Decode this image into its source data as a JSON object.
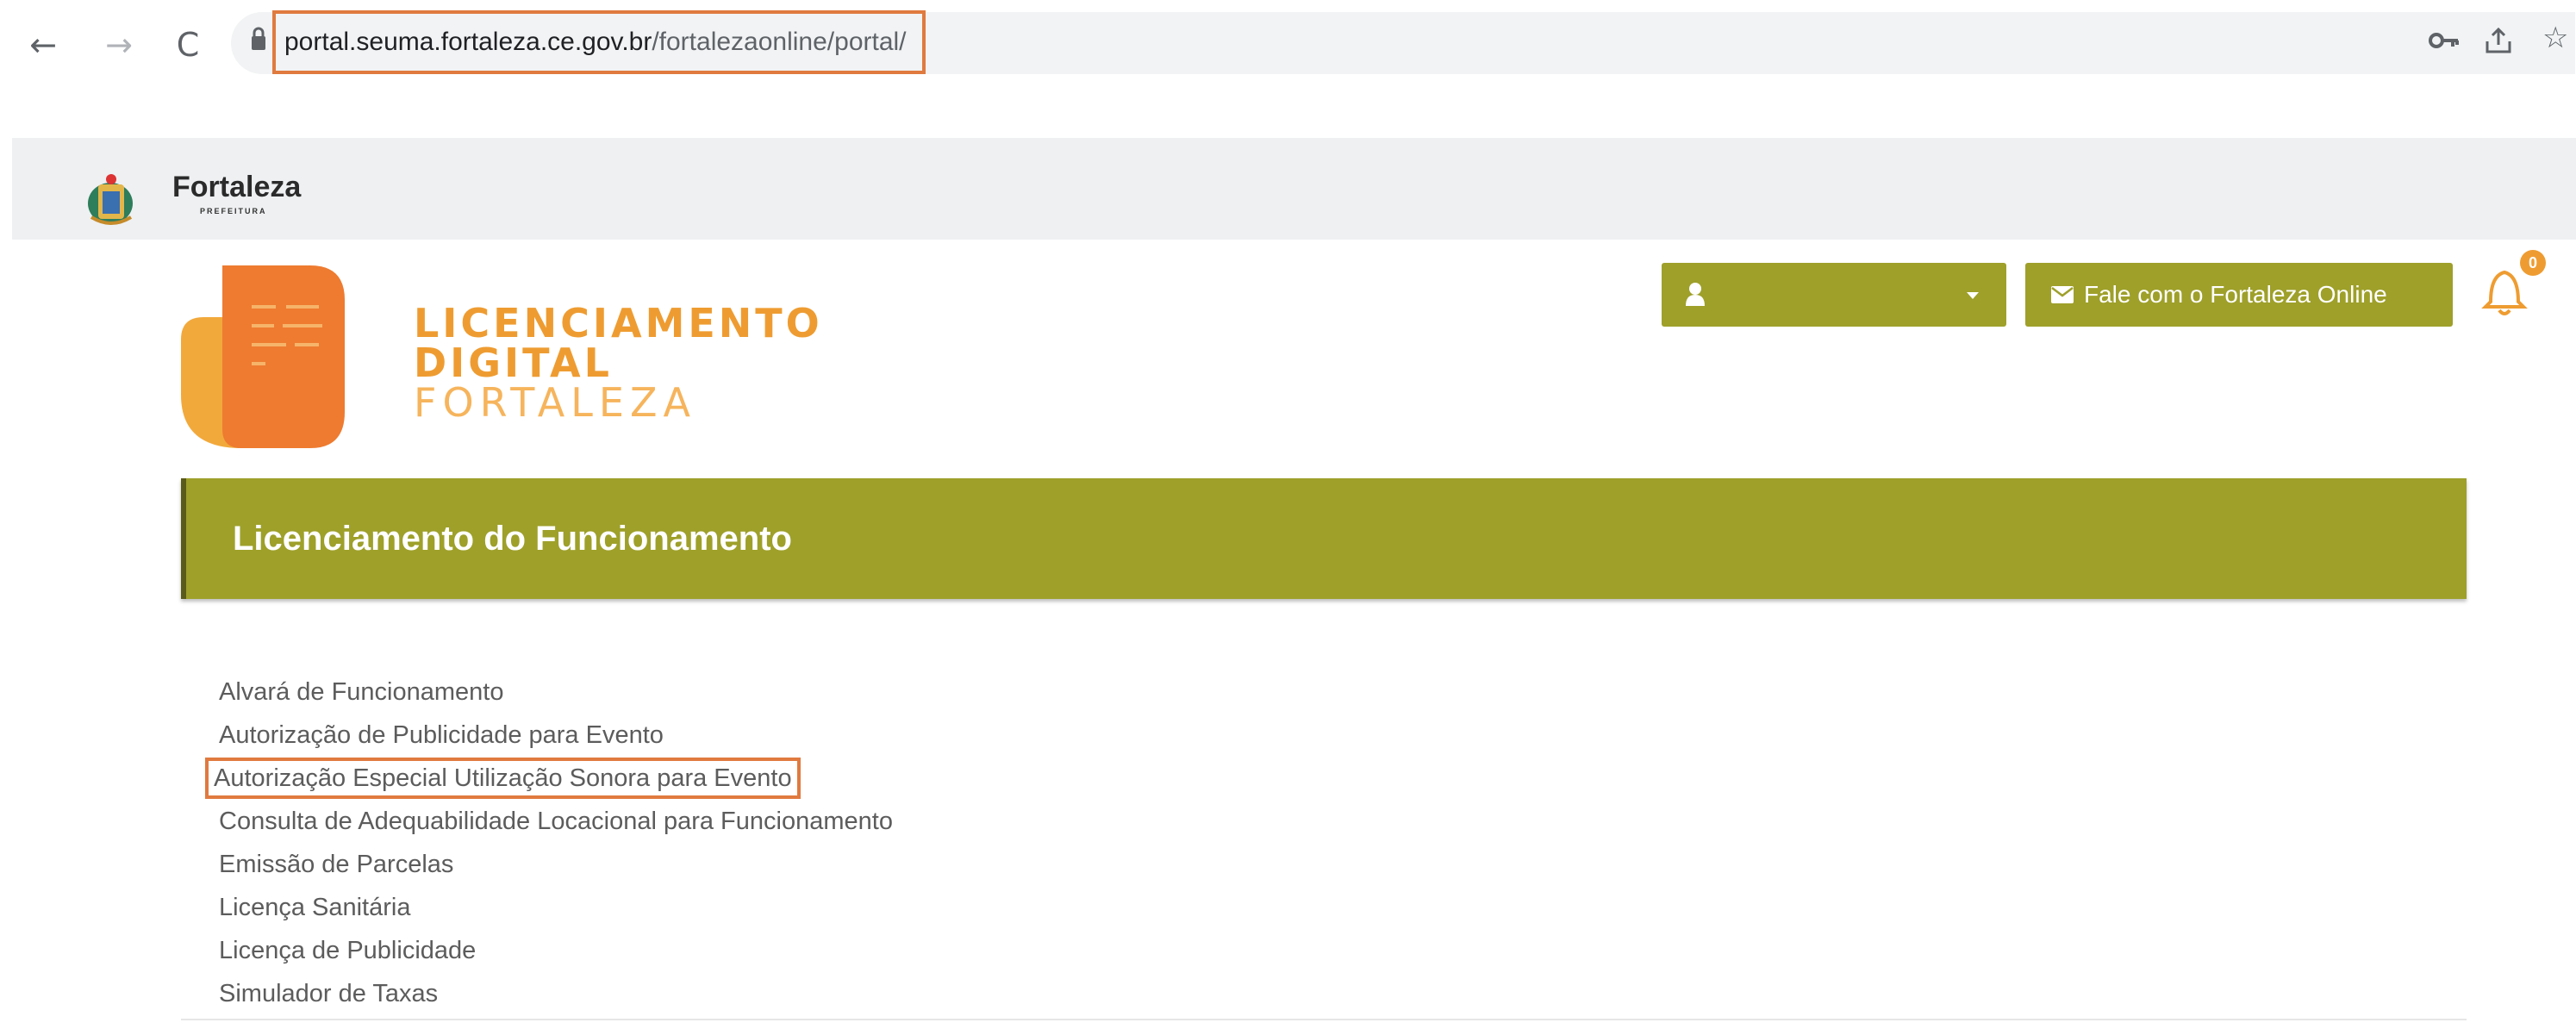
{
  "browser": {
    "url_host": "portal.seuma.fortaleza.ce.gov.br",
    "url_path": "/fortalezaonline/portal/"
  },
  "header": {
    "gov_title": "Fortaleza",
    "gov_subtitle": "PREFEITURA"
  },
  "brand": {
    "line1": "LICENCIAMENTO",
    "line2": "DIGITAL",
    "line3": "FORTALEZA",
    "color_primary": "#ee9c31"
  },
  "topbar": {
    "user_label": "",
    "contact_label": "Fale com o Fortaleza Online",
    "notification_count": "0",
    "accent_color": "#9ea02a"
  },
  "section": {
    "title": "Licenciamento do Funcionamento"
  },
  "services": [
    {
      "label": "Alvará de Funcionamento"
    },
    {
      "label": "Autorização de Publicidade para Evento"
    },
    {
      "label": "Autorização Especial Utilização Sonora para Evento"
    },
    {
      "label": "Consulta de Adequabilidade Locacional para Funcionamento"
    },
    {
      "label": "Emissão de Parcelas"
    },
    {
      "label": "Licença Sanitária"
    },
    {
      "label": "Licença de Publicidade"
    },
    {
      "label": "Simulador de Taxas"
    }
  ]
}
